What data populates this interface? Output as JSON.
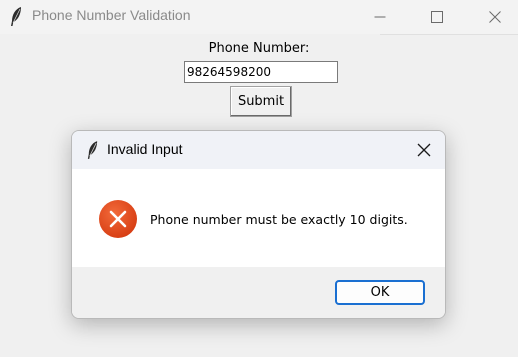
{
  "app": {
    "title": "Phone Number Validation",
    "icon": "feather-icon"
  },
  "form": {
    "label": "Phone Number:",
    "phone_value": "98264598200",
    "submit_label": "Submit"
  },
  "dialog": {
    "title": "Invalid Input",
    "message": "Phone number must be exactly 10 digits.",
    "ok_label": "OK",
    "icon": "error-icon",
    "error_color": "#e04a1c",
    "accent_color": "#1a6fd1"
  }
}
